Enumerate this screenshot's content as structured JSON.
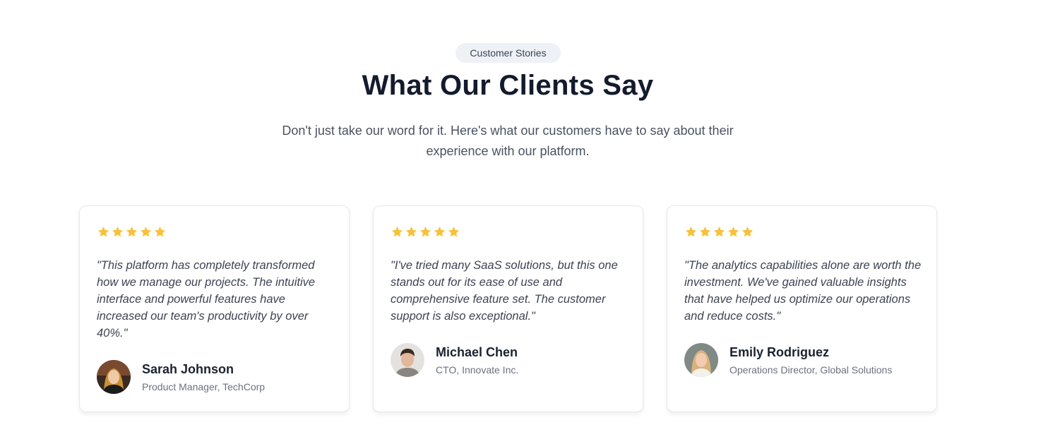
{
  "section": {
    "eyebrow": "Customer Stories",
    "title": "What Our Clients Say",
    "subtitle": "Don't just take our word for it. Here's what our customers have to say about their experience with our platform."
  },
  "colors": {
    "star": "#f5c23a",
    "heading": "#141b2d",
    "body_text": "#4a5261",
    "badge_bg": "#eef1f6"
  },
  "testimonials": [
    {
      "rating": 5,
      "quote": "\"This platform has completely transformed how we manage our projects. The intuitive interface and powerful features have increased our team's productivity by over 40%.\"",
      "name": "Sarah Johnson",
      "role": "Product Manager, TechCorp",
      "avatar_icon": "woman-avatar-photo"
    },
    {
      "rating": 5,
      "quote": "\"I've tried many SaaS solutions, but this one stands out for its ease of use and comprehensive feature set. The customer support is also exceptional.\"",
      "name": "Michael Chen",
      "role": "CTO, Innovate Inc.",
      "avatar_icon": "man-avatar-photo"
    },
    {
      "rating": 5,
      "quote": "\"The analytics capabilities alone are worth the investment. We've gained valuable insights that have helped us optimize our operations and reduce costs.\"",
      "name": "Emily Rodriguez",
      "role": "Operations Director, Global Solutions",
      "avatar_icon": "woman-avatar-photo"
    }
  ]
}
